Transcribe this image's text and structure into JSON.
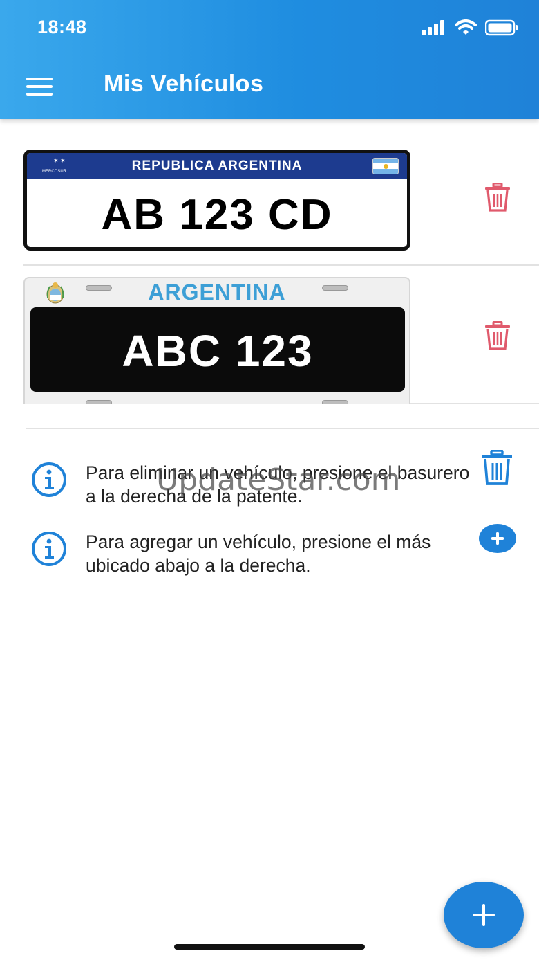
{
  "status_bar": {
    "time": "18:48",
    "signal_icon": "signal-icon",
    "wifi_icon": "wifi-icon",
    "battery_icon": "battery-icon"
  },
  "app_bar": {
    "title": "Mis Vehículos",
    "menu_icon": "menu-icon"
  },
  "vehicles": [
    {
      "style": "mercosur",
      "header": "REPUBLICA ARGENTINA",
      "brand": "MERCOSUR",
      "plate": "AB 123 CD",
      "delete_icon": "trash-icon"
    },
    {
      "style": "old-argentina",
      "header": "ARGENTINA",
      "plate": "ABC 123",
      "delete_icon": "trash-icon"
    }
  ],
  "info": [
    {
      "text": "Para eliminar un vehículo, presione el basurero a la derecha de la patente.",
      "icon": "info-icon",
      "hint_icon": "trash-icon"
    },
    {
      "text": "Para agregar un vehículo, presione el más ubicado abajo a la derecha.",
      "icon": "info-icon",
      "hint_icon": "add-circle-icon"
    }
  ],
  "watermark": "UpdateStar.com",
  "fab": {
    "icon": "plus-icon"
  },
  "colors": {
    "primary": "#1f82d8",
    "delete": "#e05a6c",
    "plate_band": "#1d3b8f"
  }
}
